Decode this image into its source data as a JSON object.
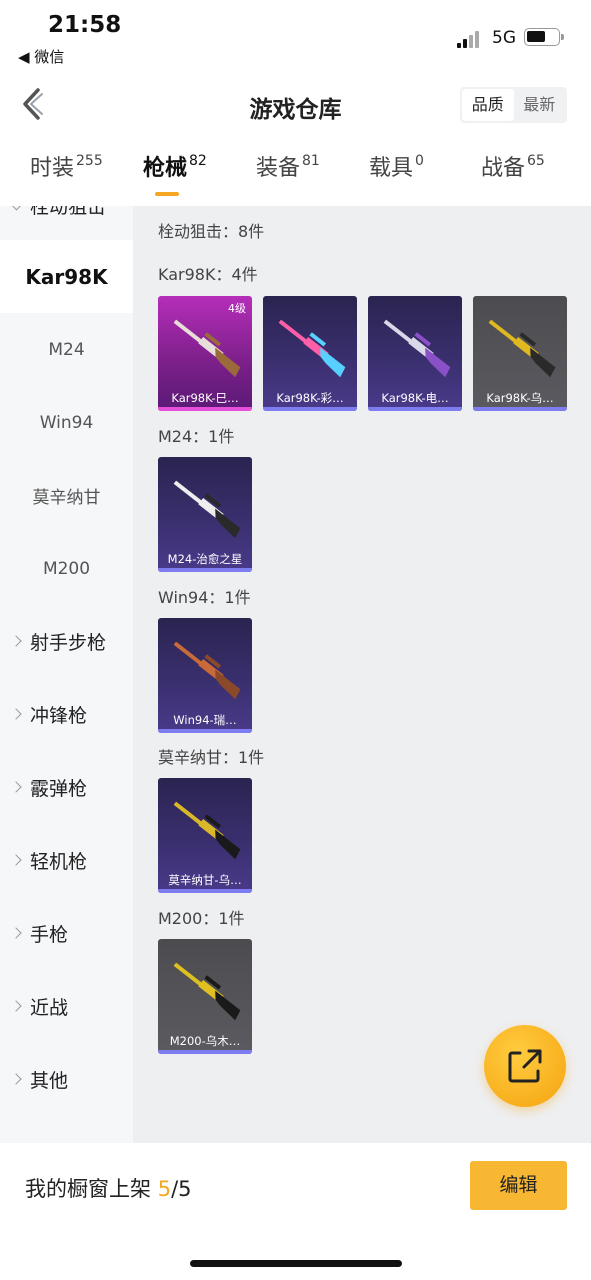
{
  "status_bar": {
    "time": "21:58",
    "back_app": "◀ 微信",
    "network": "5G"
  },
  "header": {
    "title": "游戏仓库",
    "sort_options": [
      "品质",
      "最新"
    ],
    "sort_selected": "品质"
  },
  "tabs": [
    {
      "label": "时装",
      "count": "255"
    },
    {
      "label": "枪械",
      "count": "82",
      "active": true
    },
    {
      "label": "装备",
      "count": "81"
    },
    {
      "label": "载具",
      "count": "0"
    },
    {
      "label": "战备",
      "count": "65"
    }
  ],
  "sidebar": {
    "top_partial": "栓动狙击",
    "subitems": [
      "Kar98K",
      "M24",
      "Win94",
      "莫辛纳甘",
      "M200"
    ],
    "active_subitem": "Kar98K",
    "groups": [
      "射手步枪",
      "冲锋枪",
      "霰弹枪",
      "轻机枪",
      "手枪",
      "近战",
      "其他"
    ]
  },
  "content": {
    "category_summary": "栓动狙击：8件",
    "sections": [
      {
        "title": "Kar98K：4件",
        "items": [
          {
            "caption": "Kar98K-巳…",
            "level": "4级",
            "bg": "pink",
            "gun_color": "#e8e0d8",
            "gun_accent": "#9a6a3a"
          },
          {
            "caption": "Kar98K-彩…",
            "bg": "purple",
            "gun_color": "#ff5fa8",
            "gun_accent": "#58d0ff"
          },
          {
            "caption": "Kar98K-电…",
            "bg": "purple",
            "gun_color": "#d8d8e8",
            "gun_accent": "#8a50c8"
          },
          {
            "caption": "Kar98K-乌…",
            "bg": "gray",
            "gun_color": "#e0b820",
            "gun_accent": "#2a2a2a"
          }
        ]
      },
      {
        "title": "M24：1件",
        "items": [
          {
            "caption": "M24-治愈之星",
            "bg": "purple",
            "gun_color": "#eeeeee",
            "gun_accent": "#2a2a2a"
          }
        ]
      },
      {
        "title": "Win94：1件",
        "items": [
          {
            "caption": "Win94-瑞…",
            "bg": "purple",
            "gun_color": "#c86a3a",
            "gun_accent": "#8a4a2a"
          }
        ]
      },
      {
        "title": "莫辛纳甘：1件",
        "items": [
          {
            "caption": "莫辛纳甘-乌…",
            "bg": "purple",
            "gun_color": "#d8b828",
            "gun_accent": "#1a1a1a"
          }
        ]
      },
      {
        "title": "M200：1件",
        "items": [
          {
            "caption": "M200-乌木…",
            "bg": "gray",
            "gun_color": "#e0c020",
            "gun_accent": "#1a1a1a"
          }
        ]
      }
    ]
  },
  "bottom_bar": {
    "showcase_label": "我的橱窗上架",
    "showcase_count": "5",
    "showcase_total": "/5",
    "edit_label": "编辑"
  },
  "colors": {
    "accent": "#f5a623",
    "card_bar": "#7d7cf0",
    "card_bar_pink": "#e64fd8"
  }
}
